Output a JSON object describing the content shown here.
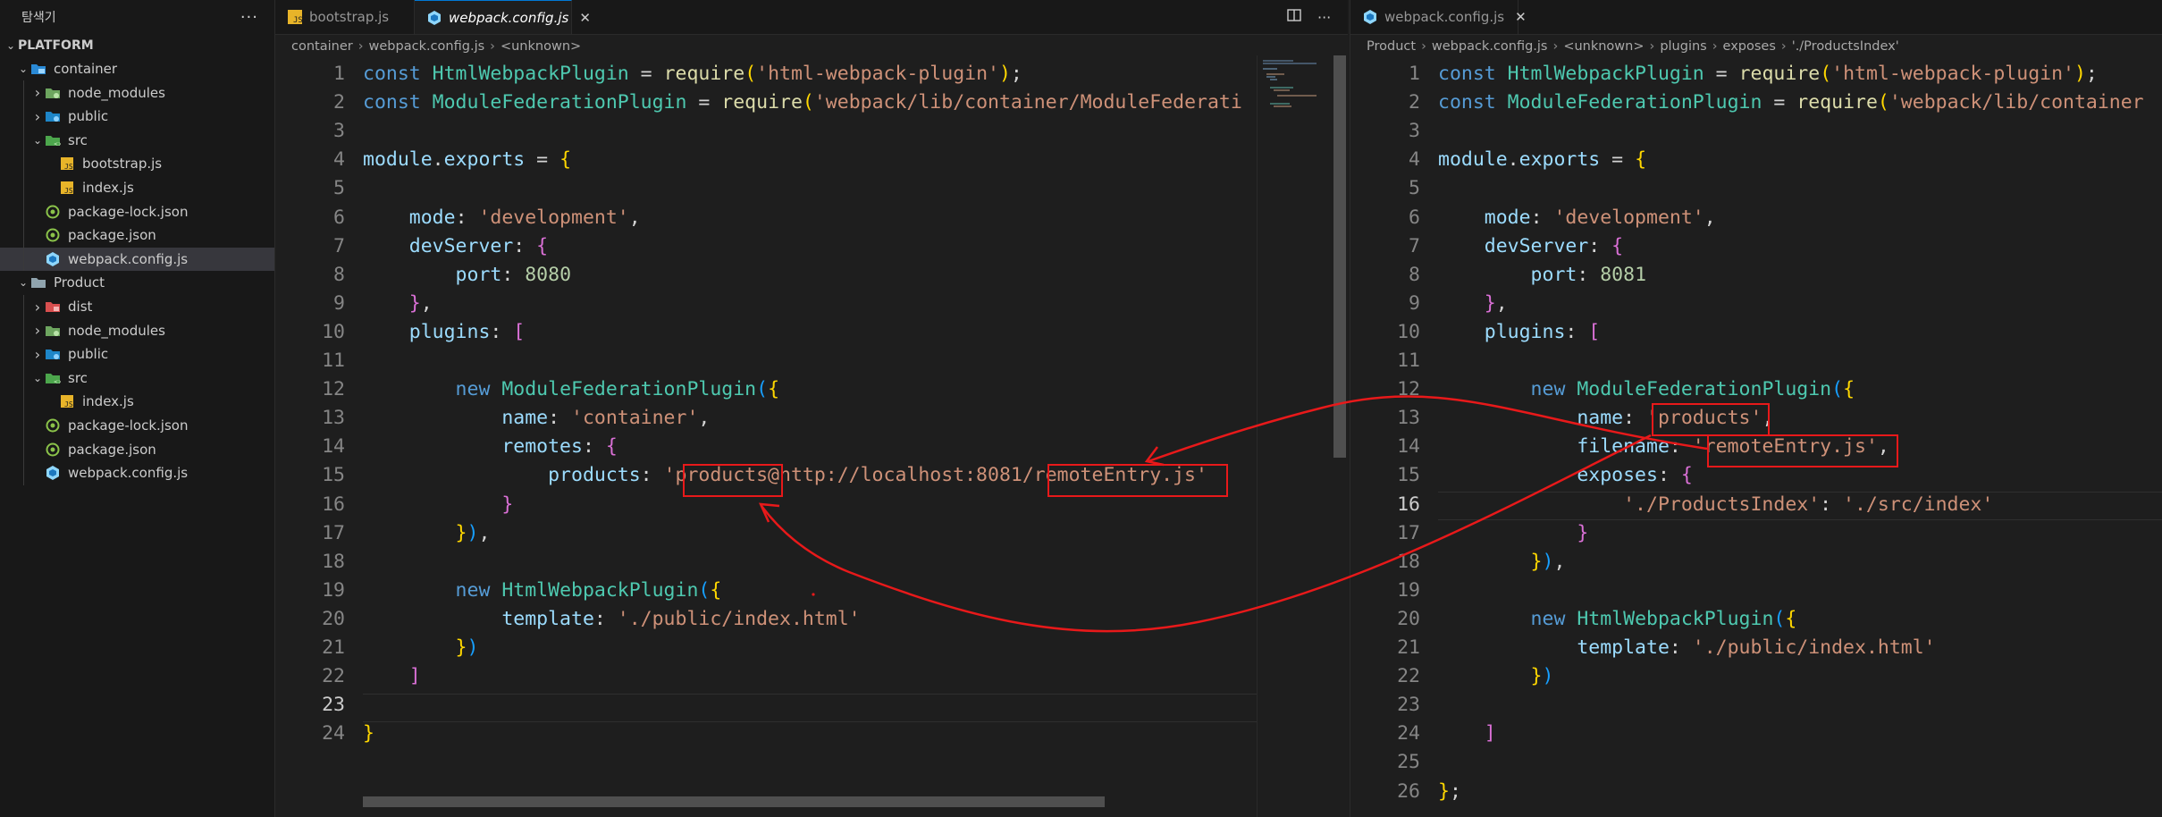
{
  "explorer": {
    "title": "탐색기",
    "more": "···",
    "root": "PLATFORM",
    "items": [
      {
        "label": "container",
        "type": "folder-open",
        "depth": 1,
        "icon": "container-folder-icon"
      },
      {
        "label": "node_modules",
        "type": "folder",
        "depth": 2,
        "icon": "node-folder-icon"
      },
      {
        "label": "public",
        "type": "folder",
        "depth": 2,
        "icon": "public-folder-icon"
      },
      {
        "label": "src",
        "type": "folder-open",
        "depth": 2,
        "icon": "src-folder-icon"
      },
      {
        "label": "bootstrap.js",
        "type": "file",
        "depth": 3,
        "icon": "js-file-icon"
      },
      {
        "label": "index.js",
        "type": "file",
        "depth": 3,
        "icon": "js-file-icon"
      },
      {
        "label": "package-lock.json",
        "type": "file",
        "depth": 2,
        "icon": "npm-file-icon"
      },
      {
        "label": "package.json",
        "type": "file",
        "depth": 2,
        "icon": "npm-file-icon"
      },
      {
        "label": "webpack.config.js",
        "type": "file",
        "depth": 2,
        "icon": "webpack-file-icon",
        "selected": true
      },
      {
        "label": "Product",
        "type": "folder-open",
        "depth": 1,
        "icon": "folder-icon"
      },
      {
        "label": "dist",
        "type": "folder",
        "depth": 2,
        "icon": "dist-folder-icon"
      },
      {
        "label": "node_modules",
        "type": "folder",
        "depth": 2,
        "icon": "node-folder-icon"
      },
      {
        "label": "public",
        "type": "folder",
        "depth": 2,
        "icon": "public-folder-icon"
      },
      {
        "label": "src",
        "type": "folder-open",
        "depth": 2,
        "icon": "src-folder-icon"
      },
      {
        "label": "index.js",
        "type": "file",
        "depth": 3,
        "icon": "js-file-icon"
      },
      {
        "label": "package-lock.json",
        "type": "file",
        "depth": 2,
        "icon": "npm-file-icon"
      },
      {
        "label": "package.json",
        "type": "file",
        "depth": 2,
        "icon": "npm-file-icon"
      },
      {
        "label": "webpack.config.js",
        "type": "file",
        "depth": 2,
        "icon": "webpack-file-icon"
      }
    ]
  },
  "left_editor": {
    "tabs": [
      {
        "label": "bootstrap.js",
        "active": false
      },
      {
        "label": "webpack.config.js",
        "active": true
      }
    ],
    "breadcrumb": [
      "container",
      "webpack.config.js",
      "<unknown>"
    ],
    "lines": [
      [
        [
          "kw",
          "const "
        ],
        [
          "cls",
          "HtmlWebpackPlugin"
        ],
        [
          "pl",
          " = "
        ],
        [
          "fn",
          "require"
        ],
        [
          "b1",
          "("
        ],
        [
          "str",
          "'html-webpack-plugin'"
        ],
        [
          "b1",
          ")"
        ],
        [
          "pl",
          ";"
        ]
      ],
      [
        [
          "kw",
          "const "
        ],
        [
          "cls",
          "ModuleFederationPlugin"
        ],
        [
          "pl",
          " = "
        ],
        [
          "fn",
          "require"
        ],
        [
          "b1",
          "("
        ],
        [
          "str",
          "'webpack/lib/container/ModuleFederati"
        ]
      ],
      [],
      [
        [
          "var",
          "module"
        ],
        [
          "pl",
          "."
        ],
        [
          "var",
          "exports"
        ],
        [
          "pl",
          " = "
        ],
        [
          "b1",
          "{"
        ]
      ],
      [],
      [
        [
          "prop",
          "    mode"
        ],
        [
          "pl",
          ": "
        ],
        [
          "str",
          "'development'"
        ],
        [
          "pl",
          ","
        ]
      ],
      [
        [
          "prop",
          "    devServer"
        ],
        [
          "pl",
          ": "
        ],
        [
          "b2",
          "{"
        ]
      ],
      [
        [
          "prop",
          "        port"
        ],
        [
          "pl",
          ": "
        ],
        [
          "num",
          "8080"
        ]
      ],
      [
        [
          "b2",
          "    }"
        ],
        [
          "pl",
          ","
        ]
      ],
      [
        [
          "prop",
          "    plugins"
        ],
        [
          "pl",
          ": "
        ],
        [
          "b2",
          "["
        ]
      ],
      [],
      [
        [
          "kw",
          "        new "
        ],
        [
          "cls",
          "ModuleFederationPlugin"
        ],
        [
          "b3",
          "("
        ],
        [
          "b1",
          "{"
        ]
      ],
      [
        [
          "prop",
          "            name"
        ],
        [
          "pl",
          ": "
        ],
        [
          "str",
          "'container'"
        ],
        [
          "pl",
          ","
        ]
      ],
      [
        [
          "prop",
          "            remotes"
        ],
        [
          "pl",
          ": "
        ],
        [
          "b2",
          "{"
        ]
      ],
      [
        [
          "prop",
          "                products"
        ],
        [
          "pl",
          ": "
        ],
        [
          "str",
          "'products@http://localhost:8081/remoteEntry.js'"
        ]
      ],
      [
        [
          "b2",
          "            }"
        ]
      ],
      [
        [
          "b1",
          "        }"
        ],
        [
          "b3",
          ")"
        ],
        [
          "pl",
          ","
        ]
      ],
      [],
      [
        [
          "kw",
          "        new "
        ],
        [
          "cls",
          "HtmlWebpackPlugin"
        ],
        [
          "b3",
          "("
        ],
        [
          "b1",
          "{"
        ]
      ],
      [
        [
          "prop",
          "            template"
        ],
        [
          "pl",
          ": "
        ],
        [
          "str",
          "'./public/index.html'"
        ]
      ],
      [
        [
          "b1",
          "        }"
        ],
        [
          "b3",
          ")"
        ]
      ],
      [
        [
          "b2",
          "    ]"
        ]
      ],
      [],
      [
        [
          "b1",
          "}"
        ]
      ]
    ],
    "current_line": 23
  },
  "right_editor": {
    "tabs": [
      {
        "label": "webpack.config.js",
        "active": false
      }
    ],
    "breadcrumb": [
      "Product",
      "webpack.config.js",
      "<unknown>",
      "plugins",
      "exposes",
      "'./ProductsIndex'"
    ],
    "lines": [
      [
        [
          "kw",
          "const "
        ],
        [
          "cls",
          "HtmlWebpackPlugin"
        ],
        [
          "pl",
          " = "
        ],
        [
          "fn",
          "require"
        ],
        [
          "b1",
          "("
        ],
        [
          "str",
          "'html-webpack-plugin'"
        ],
        [
          "b1",
          ")"
        ],
        [
          "pl",
          ";"
        ]
      ],
      [
        [
          "kw",
          "const "
        ],
        [
          "cls",
          "ModuleFederationPlugin"
        ],
        [
          "pl",
          " = "
        ],
        [
          "fn",
          "require"
        ],
        [
          "b1",
          "("
        ],
        [
          "str",
          "'webpack/lib/container"
        ]
      ],
      [],
      [
        [
          "var",
          "module"
        ],
        [
          "pl",
          "."
        ],
        [
          "var",
          "exports"
        ],
        [
          "pl",
          " = "
        ],
        [
          "b1",
          "{"
        ]
      ],
      [],
      [
        [
          "prop",
          "    mode"
        ],
        [
          "pl",
          ": "
        ],
        [
          "str",
          "'development'"
        ],
        [
          "pl",
          ","
        ]
      ],
      [
        [
          "prop",
          "    devServer"
        ],
        [
          "pl",
          ": "
        ],
        [
          "b2",
          "{"
        ]
      ],
      [
        [
          "prop",
          "        port"
        ],
        [
          "pl",
          ": "
        ],
        [
          "num",
          "8081"
        ]
      ],
      [
        [
          "b2",
          "    }"
        ],
        [
          "pl",
          ","
        ]
      ],
      [
        [
          "prop",
          "    plugins"
        ],
        [
          "pl",
          ": "
        ],
        [
          "b2",
          "["
        ]
      ],
      [],
      [
        [
          "kw",
          "        new "
        ],
        [
          "cls",
          "ModuleFederationPlugin"
        ],
        [
          "b3",
          "("
        ],
        [
          "b1",
          "{"
        ]
      ],
      [
        [
          "prop",
          "            name"
        ],
        [
          "pl",
          ": "
        ],
        [
          "str",
          "'products'"
        ],
        [
          "pl",
          ","
        ]
      ],
      [
        [
          "prop",
          "            filename"
        ],
        [
          "pl",
          ": "
        ],
        [
          "str",
          "'remoteEntry.js'"
        ],
        [
          "pl",
          ","
        ]
      ],
      [
        [
          "prop",
          "            exposes"
        ],
        [
          "pl",
          ": "
        ],
        [
          "b2",
          "{"
        ]
      ],
      [
        [
          "str",
          "                './ProductsIndex'"
        ],
        [
          "pl",
          ": "
        ],
        [
          "str",
          "'./src/index'"
        ]
      ],
      [
        [
          "b2",
          "            }"
        ]
      ],
      [
        [
          "b1",
          "        }"
        ],
        [
          "b3",
          ")"
        ],
        [
          "pl",
          ","
        ]
      ],
      [],
      [
        [
          "kw",
          "        new "
        ],
        [
          "cls",
          "HtmlWebpackPlugin"
        ],
        [
          "b3",
          "("
        ],
        [
          "b1",
          "{"
        ]
      ],
      [
        [
          "prop",
          "            template"
        ],
        [
          "pl",
          ": "
        ],
        [
          "str",
          "'./public/index.html'"
        ]
      ],
      [
        [
          "b1",
          "        }"
        ],
        [
          "b3",
          ")"
        ]
      ],
      [],
      [
        [
          "b2",
          "    ]"
        ]
      ],
      [],
      [
        [
          "b1",
          "}"
        ],
        [
          "pl",
          ";"
        ]
      ]
    ],
    "current_line": 16
  },
  "colors": {
    "annotation": "#e8191a",
    "active_tab_border": "#0078d4"
  }
}
